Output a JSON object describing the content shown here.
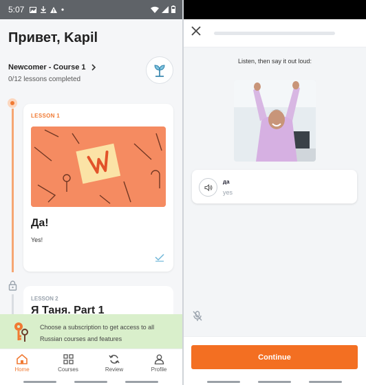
{
  "status_bar": {
    "time": "5:07"
  },
  "home": {
    "greeting": "Привет, Kapil",
    "course_title": "Newcomer - Course 1",
    "progress_text": "0/12 lessons completed",
    "lessons": [
      {
        "label": "LESSON 1",
        "title": "Да!",
        "subtitle": "Yes!"
      },
      {
        "label": "LESSON 2",
        "title": "Я Таня. Part 1"
      }
    ],
    "subscription_banner": "Choose a subscription to get access to all Russian courses and features",
    "nav": [
      {
        "label": "Home",
        "icon": "home-icon",
        "active": true
      },
      {
        "label": "Courses",
        "icon": "grid-icon",
        "active": false
      },
      {
        "label": "Review",
        "icon": "refresh-icon",
        "active": false
      },
      {
        "label": "Profile",
        "icon": "person-icon",
        "active": false
      }
    ]
  },
  "exercise": {
    "instruction": "Listen, then say it out loud:",
    "progress": 0.0,
    "word": "да",
    "translation": "yes",
    "continue_label": "Continue"
  },
  "colors": {
    "accent": "#f36f22",
    "banner": "#d9efcb"
  }
}
